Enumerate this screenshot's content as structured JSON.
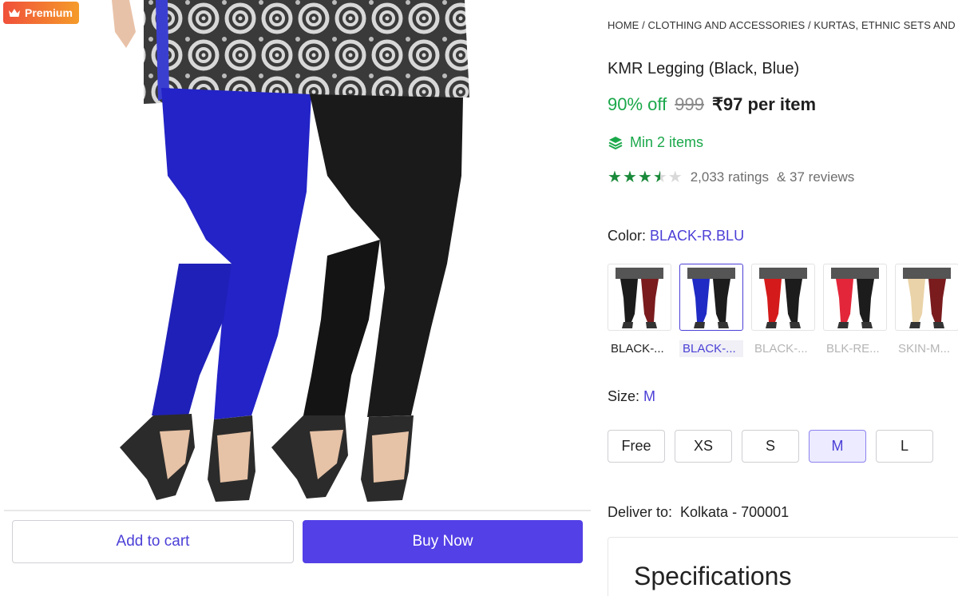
{
  "badge": {
    "label": "Premium",
    "icon": "crown-icon"
  },
  "actions": {
    "add_to_cart": "Add to cart",
    "buy_now": "Buy Now"
  },
  "breadcrumb": "HOME / CLOTHING AND ACCESSORIES / KURTAS, ETHNIC SETS AND B",
  "product": {
    "title": "KMR Legging (Black, Blue)",
    "discount": "90% off",
    "mrp": "999",
    "price": "₹97 per item",
    "min_items": "Min 2 items",
    "rating_stars": 3.5,
    "ratings": "2,033 ratings",
    "reviews": "& 37 reviews"
  },
  "color": {
    "label": "Color:",
    "selected": "BLACK-R.BLU",
    "options": [
      {
        "label": "BLACK-...",
        "colors": [
          "#1c1c1c",
          "#7a1b1e"
        ],
        "state": "normal"
      },
      {
        "label": "BLACK-...",
        "colors": [
          "#1f2bc4",
          "#1c1c1c"
        ],
        "state": "selected"
      },
      {
        "label": "BLACK-...",
        "colors": [
          "#d41a1a",
          "#1c1c1c"
        ],
        "state": "oos"
      },
      {
        "label": "BLK-RE...",
        "colors": [
          "#e3263a",
          "#1c1c1c"
        ],
        "state": "oos"
      },
      {
        "label": "SKIN-M...",
        "colors": [
          "#ead3a8",
          "#7a1b1e"
        ],
        "state": "oos"
      }
    ]
  },
  "size": {
    "label": "Size:",
    "selected": "M",
    "options": [
      "Free",
      "XS",
      "S",
      "M",
      "L"
    ]
  },
  "delivery": {
    "label": "Deliver to:",
    "location": "Kolkata - 700001"
  },
  "specifications": {
    "title": "Specifications"
  },
  "colors": {
    "accent": "#5340e6",
    "green": "#1aa84a",
    "blue_legging": "#1f2bc4",
    "black_legging": "#1a1a1a"
  }
}
